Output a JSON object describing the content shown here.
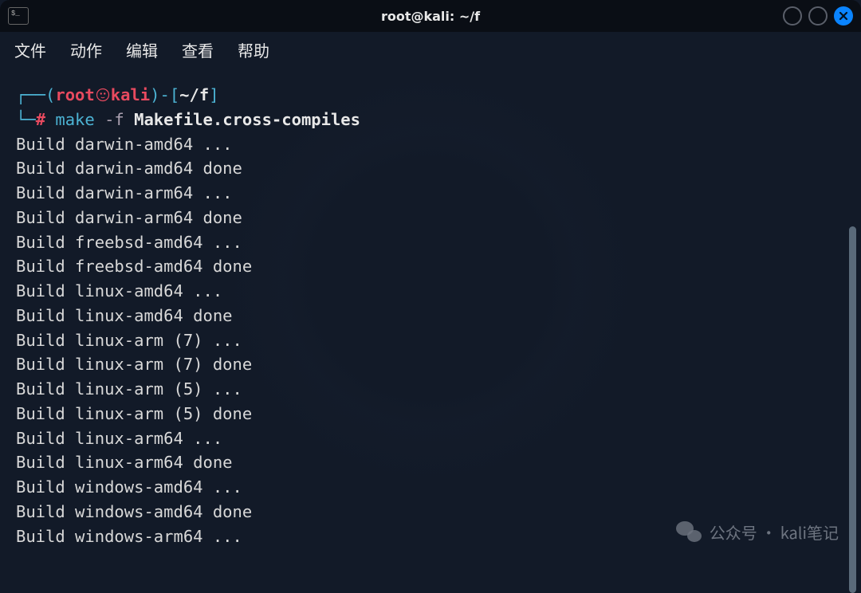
{
  "window": {
    "title": "root@kali: ~/f",
    "app_icon_text": "$_"
  },
  "menu": {
    "file": "文件",
    "action": "动作",
    "edit": "编辑",
    "view": "查看",
    "help": "帮助"
  },
  "prompt": {
    "box_top": "┌──",
    "paren_open": "(",
    "user": "root",
    "sep_symbol": "㉿",
    "host": "kali",
    "paren_close": ")",
    "dash": "-",
    "bracket_open": "[",
    "path": "~/f",
    "bracket_close": "]",
    "box_bottom": "└─",
    "hash": "#",
    "cmd": "make",
    "flag": "-f",
    "arg": "Makefile.cross-compiles"
  },
  "output": [
    "Build darwin-amd64 ...",
    "Build darwin-amd64 done",
    "Build darwin-arm64 ...",
    "Build darwin-arm64 done",
    "Build freebsd-amd64 ...",
    "Build freebsd-amd64 done",
    "Build linux-amd64 ...",
    "Build linux-amd64 done",
    "Build linux-arm (7) ...",
    "Build linux-arm (7) done",
    "Build linux-arm (5) ...",
    "Build linux-arm (5) done",
    "Build linux-arm64 ...",
    "Build linux-arm64 done",
    "Build windows-amd64 ...",
    "Build windows-amd64 done",
    "Build windows-arm64 ..."
  ],
  "watermark": {
    "text": "公众号 · kali笔记"
  }
}
